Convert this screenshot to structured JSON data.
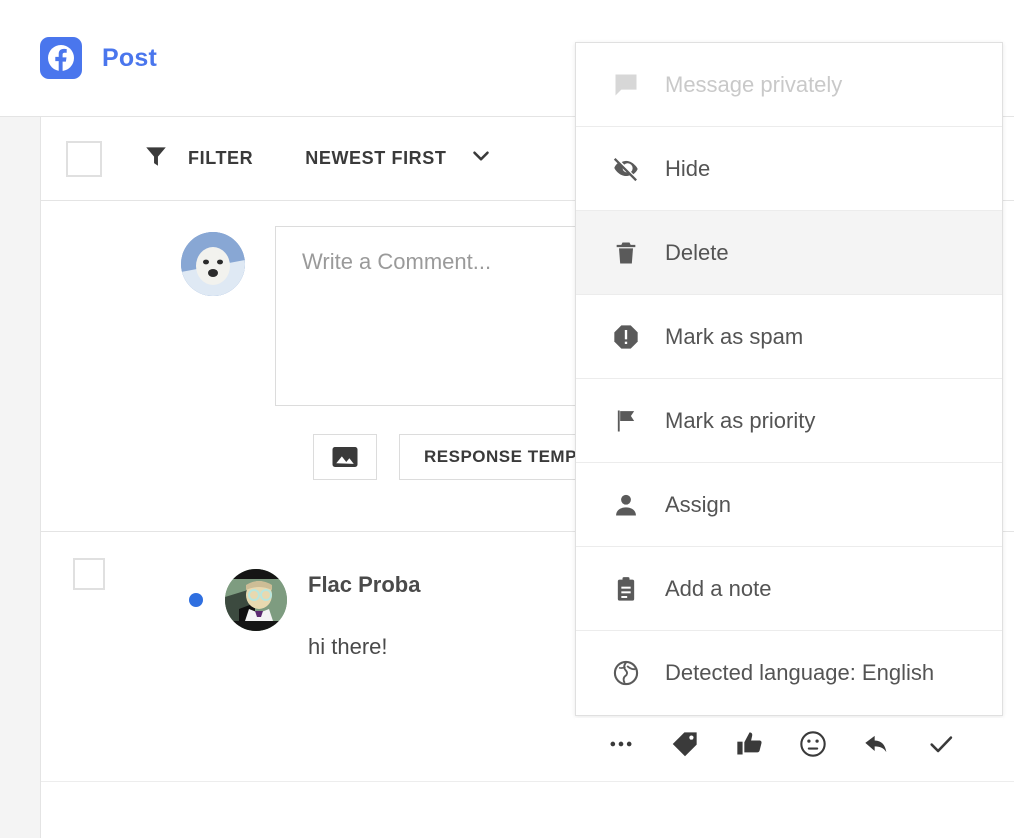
{
  "header": {
    "logo_icon": "facebook-icon",
    "title": "Post",
    "brand_color": "#4a76ed"
  },
  "toolbar": {
    "select_all_checkbox": "",
    "filter_icon": "funnel-icon",
    "filter_label": "FILTER",
    "sort_label": "NEWEST FIRST",
    "sort_chevron_icon": "chevron-down-icon"
  },
  "composer": {
    "avatar_icon": "seal-avatar",
    "placeholder": "Write a Comment...",
    "value": "",
    "image_button_icon": "image-icon",
    "response_templates_label": "RESPONSE TEMPLATES"
  },
  "comment": {
    "checkbox": "",
    "unread_dot_color": "#2f6fe0",
    "avatar_icon": "professor-avatar",
    "author": "Flac Proba",
    "text": "hi there!"
  },
  "menu": {
    "items": [
      {
        "icon": "chat-bubble-icon",
        "label": "Message privately",
        "state": "disabled"
      },
      {
        "icon": "eye-off-icon",
        "label": "Hide",
        "state": "normal"
      },
      {
        "icon": "trash-icon",
        "label": "Delete",
        "state": "highlighted"
      },
      {
        "icon": "error-octagon-icon",
        "label": "Mark as spam",
        "state": "normal"
      },
      {
        "icon": "flag-icon",
        "label": "Mark as priority",
        "state": "normal"
      },
      {
        "icon": "person-icon",
        "label": "Assign",
        "state": "normal"
      },
      {
        "icon": "clipboard-icon",
        "label": "Add a note",
        "state": "normal"
      },
      {
        "icon": "globe-icon",
        "label": "Detected language: English",
        "state": "normal"
      }
    ]
  },
  "action_bar": {
    "buttons": [
      {
        "icon": "ellipsis-icon",
        "name": "more-options"
      },
      {
        "icon": "tag-icon",
        "name": "tag"
      },
      {
        "icon": "thumbs-up-icon",
        "name": "like"
      },
      {
        "icon": "emoji-icon",
        "name": "emoji"
      },
      {
        "icon": "reply-arrow-icon",
        "name": "reply"
      },
      {
        "icon": "check-icon",
        "name": "done"
      }
    ]
  }
}
